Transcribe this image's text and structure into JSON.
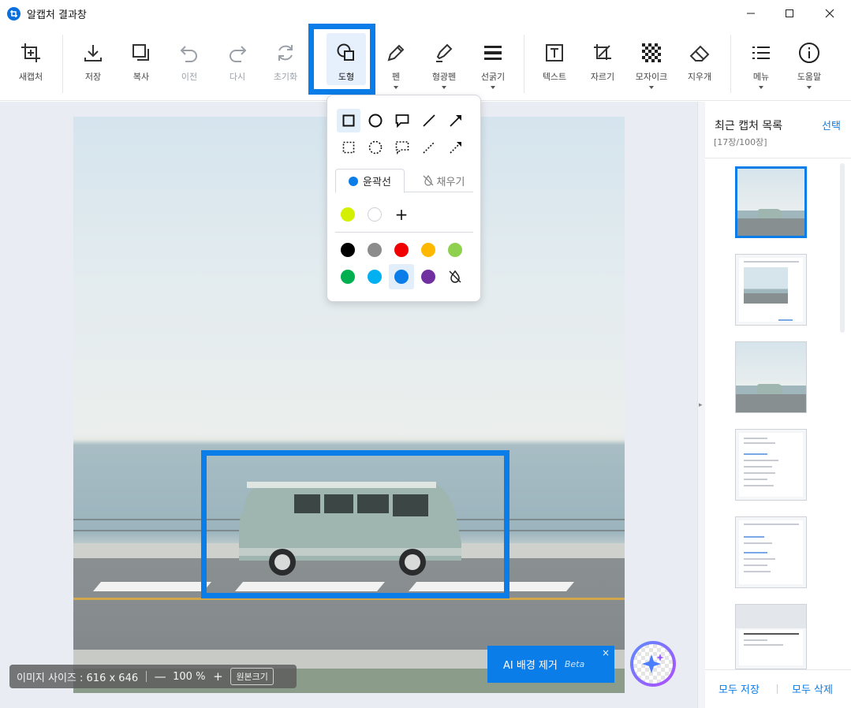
{
  "window": {
    "title": "알캡처 결과창",
    "minimize_icon": "minimize-icon",
    "maximize_icon": "maximize-icon",
    "close_icon": "close-icon"
  },
  "toolbar": {
    "items": [
      {
        "id": "new-capture",
        "label": "새캡처",
        "icon": "crop-plus-icon",
        "enabled": true
      },
      {
        "id": "save",
        "label": "저장",
        "icon": "download-icon",
        "enabled": true
      },
      {
        "id": "copy",
        "label": "복사",
        "icon": "copy-icon",
        "enabled": true
      },
      {
        "id": "undo",
        "label": "이전",
        "icon": "undo-icon",
        "enabled": false
      },
      {
        "id": "redo",
        "label": "다시",
        "icon": "redo-icon",
        "enabled": false
      },
      {
        "id": "reset",
        "label": "초기화",
        "icon": "refresh-icon",
        "enabled": false
      },
      {
        "id": "shape",
        "label": "도형",
        "icon": "shapes-icon",
        "enabled": true,
        "active": true
      },
      {
        "id": "pen",
        "label": "펜",
        "icon": "pen-icon",
        "enabled": true,
        "dropdown": true
      },
      {
        "id": "highlighter",
        "label": "형광펜",
        "icon": "highlighter-icon",
        "enabled": true,
        "dropdown": true
      },
      {
        "id": "line-width",
        "label": "선굵기",
        "icon": "line-width-icon",
        "enabled": true,
        "dropdown": true
      },
      {
        "id": "text",
        "label": "텍스트",
        "icon": "text-icon",
        "enabled": true
      },
      {
        "id": "crop",
        "label": "자르기",
        "icon": "crop-icon",
        "enabled": true
      },
      {
        "id": "mosaic",
        "label": "모자이크",
        "icon": "mosaic-icon",
        "enabled": true,
        "dropdown": true
      },
      {
        "id": "eraser",
        "label": "지우개",
        "icon": "eraser-icon",
        "enabled": true
      },
      {
        "id": "menu",
        "label": "메뉴",
        "icon": "menu-icon",
        "enabled": true,
        "dropdown": true
      },
      {
        "id": "help",
        "label": "도움말",
        "icon": "info-icon",
        "enabled": true,
        "dropdown": true
      }
    ]
  },
  "shape_popup": {
    "shapes": [
      "rectangle-icon",
      "circle-icon",
      "speech-bubble-icon",
      "line-icon",
      "arrow-icon"
    ],
    "dashed_shapes": [
      "dashed-rectangle-icon",
      "dashed-circle-icon",
      "dashed-speech-bubble-icon",
      "dashed-line-icon",
      "dashed-arrow-icon"
    ],
    "tab_outline": "윤곽선",
    "tab_fill": "채우기",
    "recent_colors": [
      "#d4f000",
      "#ffffff"
    ],
    "add_color_label": "+",
    "palette": [
      "#000000",
      "#8c8c8c",
      "#f00000",
      "#ffb800",
      "#8fd14f",
      "#00b050",
      "#00b0f0",
      "#0a7de8",
      "#7030a0"
    ],
    "selected_color": "#0a7de8",
    "no_color_icon": "no-color-icon"
  },
  "status": {
    "image_size": "이미지 사이즈 : 616 x 646",
    "zoom_out": "—",
    "zoom": "100 %",
    "zoom_in": "+",
    "original_size": "원본크기"
  },
  "ai": {
    "button_label": "AI 배경 제거",
    "beta": "Beta",
    "close": "×",
    "orb_icon": "sparkle-icon"
  },
  "sidebar": {
    "title": "최근 캡처 목록",
    "select": "선택",
    "count": "[17장/100장]",
    "save_all": "모두 저장",
    "delete_all": "모두 삭제"
  },
  "colors": {
    "accent": "#0a7de8",
    "canvas_bg": "#e9ecf2"
  }
}
